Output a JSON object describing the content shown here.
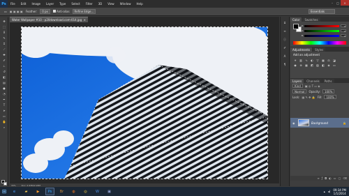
{
  "app": {
    "logo": "Ps"
  },
  "menu": [
    "File",
    "Edit",
    "Image",
    "Layer",
    "Type",
    "Select",
    "Filter",
    "3D",
    "View",
    "Window",
    "Help"
  ],
  "options": {
    "feather_label": "Feather:",
    "feather_value": "0 px",
    "anti_alias": "Anti-alias",
    "refine_edge": "Refine Edge...",
    "workspace": "Essentials"
  },
  "document": {
    "tab_title": "Water Wallpaper #10 - p20download.com-014.jpg @ 33% (RGB/8#)",
    "zoom": "33%",
    "doc_size": "Doc: 2.93M/2.93M"
  },
  "color_panel": {
    "tabs": [
      "Color",
      "Swatches"
    ],
    "r": "0",
    "g": "0",
    "b": "0",
    "r_label": "R",
    "g_label": "G",
    "b_label": "B"
  },
  "adjust_panel": {
    "tabs": [
      "Adjustments",
      "Styles"
    ],
    "title": "Add an adjustment"
  },
  "layers_panel": {
    "tabs": [
      "Layers",
      "Channels",
      "Paths"
    ],
    "kind": "Kind",
    "blend": "Normal",
    "opacity_label": "Opacity:",
    "opacity": "100%",
    "lock_label": "Lock:",
    "fill_label": "Fill:",
    "fill": "100%",
    "layer_name": "Background"
  },
  "taskbar": {
    "time": "09:34 PM",
    "date": "1/1/2014"
  },
  "icons": {
    "start": "windows-start-icon"
  }
}
